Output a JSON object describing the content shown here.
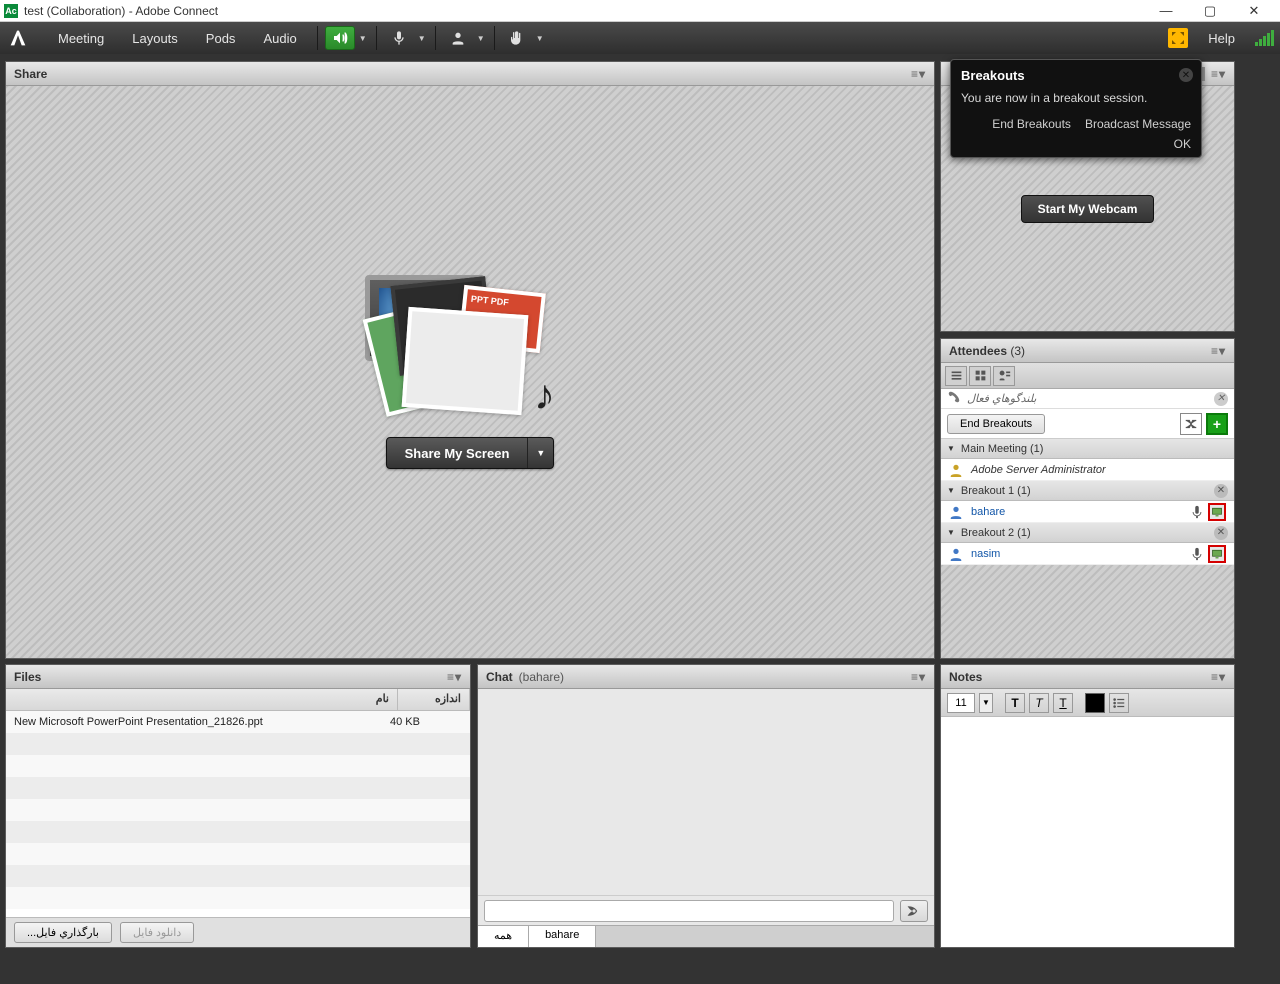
{
  "window": {
    "title": "test (Collaboration) - Adobe Connect"
  },
  "menu": {
    "meeting": "Meeting",
    "layouts": "Layouts",
    "pods": "Pods",
    "audio": "Audio",
    "help": "Help"
  },
  "share_pod": {
    "title": "Share",
    "stack_label": "PPT\nPDF",
    "button_label": "Share My Screen"
  },
  "breakouts_popup": {
    "title": "Breakouts",
    "message": "You are now in a breakout session.",
    "end": "End Breakouts",
    "broadcast": "Broadcast Message",
    "ok": "OK"
  },
  "video_pod": {
    "start_webcam": "Start My Webcam"
  },
  "attendees_pod": {
    "title": "Attendees",
    "count": "(3)",
    "active_speakers": "بلندگوهاي فعال",
    "end_breakouts": "End Breakouts",
    "groups": [
      {
        "label": "Main Meeting (1)",
        "users": [
          {
            "name": "Adobe Server Administrator",
            "role": "admin",
            "mic": false,
            "screen": false
          }
        ]
      },
      {
        "label": "Breakout 1 (1)",
        "closable": true,
        "users": [
          {
            "name": "bahare",
            "role": "participant",
            "mic": true,
            "screen": true
          }
        ]
      },
      {
        "label": "Breakout 2 (1)",
        "closable": true,
        "users": [
          {
            "name": "nasim",
            "role": "participant",
            "mic": true,
            "screen": true
          }
        ]
      }
    ]
  },
  "files_pod": {
    "title": "Files",
    "col_name": "نام",
    "col_size": "اندازه",
    "rows": [
      {
        "name": "New Microsoft PowerPoint Presentation_21826.ppt",
        "size": "40 KB"
      }
    ],
    "upload": "بارگذاري فايل...",
    "download": "دانلود فايل"
  },
  "chat_pod": {
    "title": "Chat",
    "subtitle": "(bahare)",
    "tabs": [
      "همه",
      "bahare"
    ]
  },
  "notes_pod": {
    "title": "Notes",
    "font_size": "11"
  }
}
